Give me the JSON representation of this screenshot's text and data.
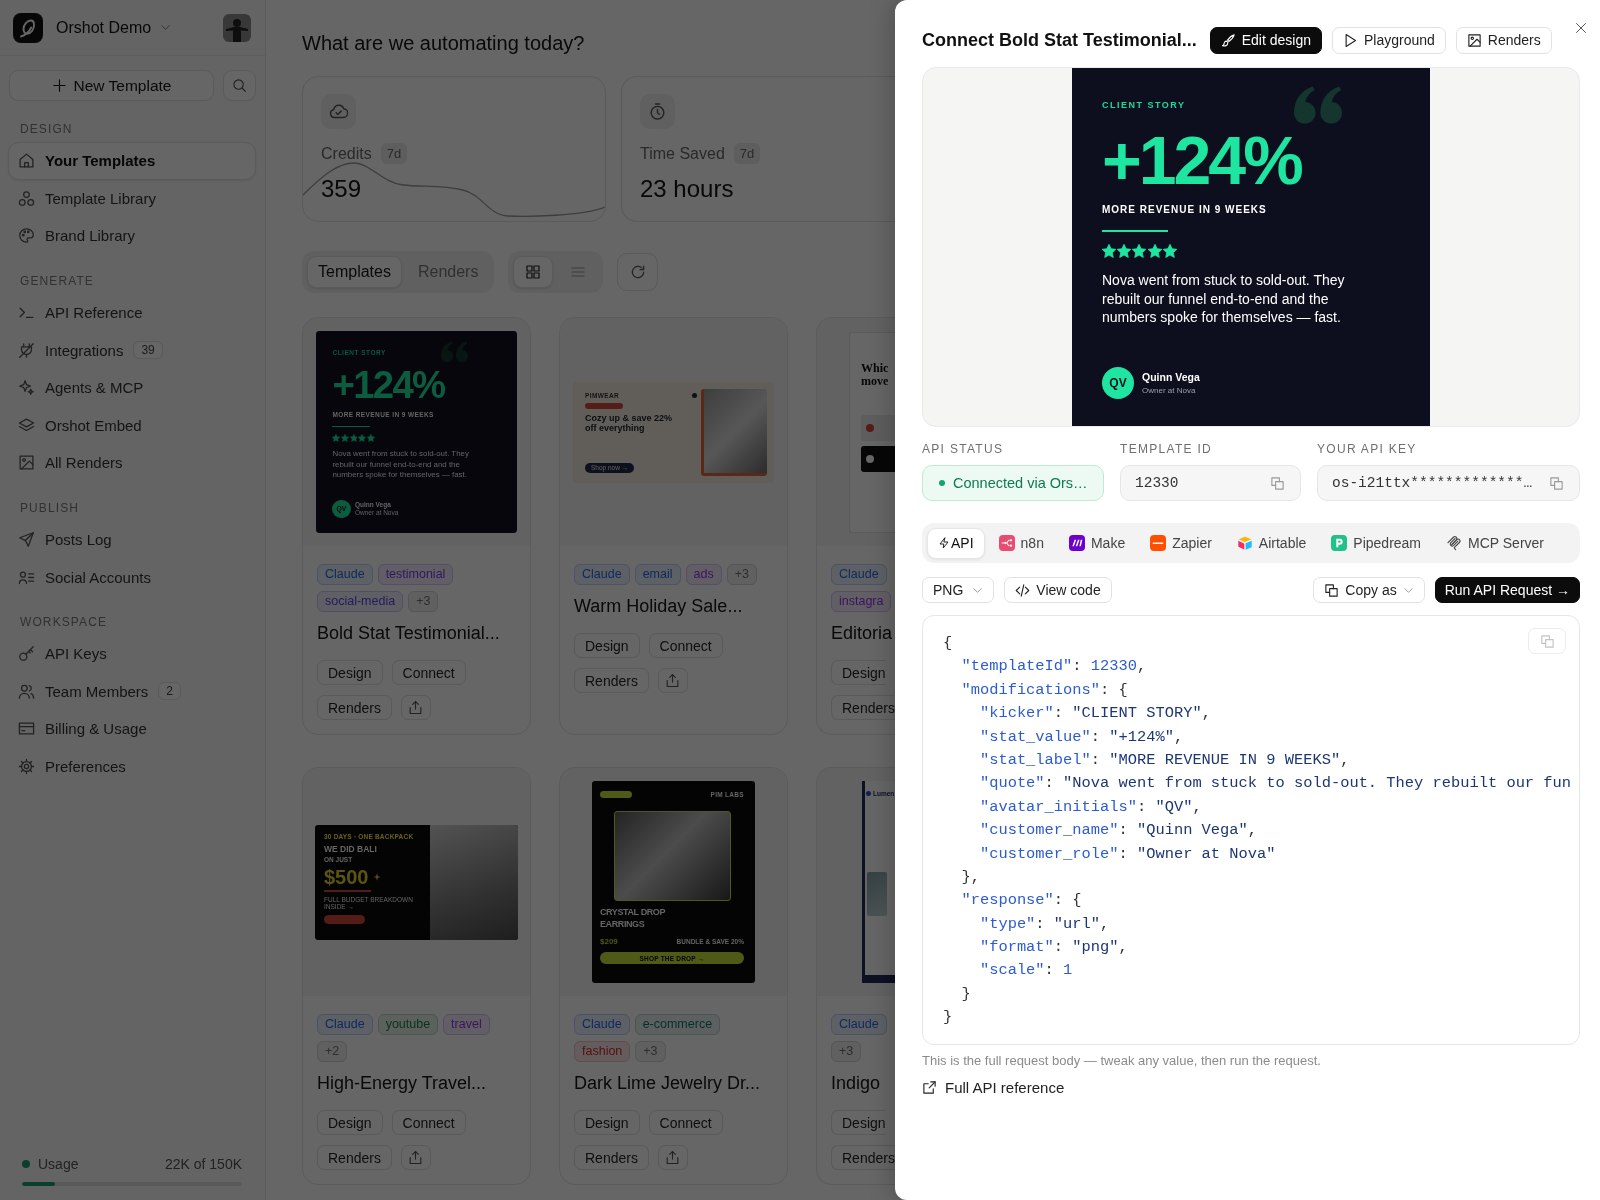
{
  "sidebar": {
    "workspace": "Orshot Demo",
    "new_template": "New Template",
    "sections": [
      {
        "title": "DESIGN",
        "items": [
          {
            "label": "Your Templates",
            "selected": true
          },
          {
            "label": "Template Library",
            "selected": false
          },
          {
            "label": "Brand Library",
            "selected": false
          }
        ]
      },
      {
        "title": "GENERATE",
        "items": [
          {
            "label": "API Reference",
            "selected": false
          },
          {
            "label": "Integrations",
            "badge": "39",
            "selected": false
          },
          {
            "label": "Agents & MCP",
            "selected": false
          },
          {
            "label": "Orshot Embed",
            "selected": false
          },
          {
            "label": "All Renders",
            "selected": false
          }
        ]
      },
      {
        "title": "PUBLISH",
        "items": [
          {
            "label": "Posts Log",
            "selected": false
          },
          {
            "label": "Social Accounts",
            "selected": false
          }
        ]
      },
      {
        "title": "WORKSPACE",
        "items": [
          {
            "label": "API Keys",
            "selected": false
          },
          {
            "label": "Team Members",
            "badge": "2",
            "selected": false
          },
          {
            "label": "Billing & Usage",
            "selected": false
          },
          {
            "label": "Preferences",
            "selected": false
          }
        ]
      }
    ],
    "usage": {
      "label": "Usage",
      "reading": "22K of 150K",
      "level": 0.15
    }
  },
  "main": {
    "title": "What are we automating today?",
    "stats": [
      {
        "label": "Credits",
        "period": "7d",
        "value": "359",
        "sparkline": true
      },
      {
        "label": "Time Saved",
        "period": "7d",
        "value": "23 hours",
        "sparkline": false
      }
    ],
    "tabs": [
      {
        "label": "Templates",
        "selected": true
      },
      {
        "label": "Renders",
        "selected": false
      }
    ],
    "view_modes": [
      {
        "selected": true
      },
      {
        "selected": false
      }
    ],
    "templates": [
      {
        "preview": {
          "kind": "testimonial",
          "kicker": "CLIENT STORY",
          "stat": "+124%",
          "stat_label": "MORE REVENUE IN 9 WEEKS",
          "stars": 5,
          "quote": "Nova went from stuck to sold-out. They rebuilt our funnel end-to-end and the numbers spoke for themselves — fast.",
          "initials": "QV",
          "name": "Quinn Vega",
          "role": "Owner at Nova"
        },
        "tags": [
          {
            "label": "Claude",
            "color": "#0f285e"
          },
          {
            "label": "testimonial",
            "color": "#32175f"
          },
          {
            "label": "social-media",
            "color": "#201c5c"
          },
          {
            "label": "+3",
            "color": "#2e2e2e"
          }
        ],
        "title": "Bold Stat Testimonial...",
        "button_rows": [
          [
            "Design",
            "Connect"
          ],
          [
            "Renders"
          ]
        ],
        "share": true
      },
      {
        "preview": {
          "kind": "promo_banner",
          "brand": "PIMWEAR",
          "heading": "Cozy up & save 22% off everything",
          "button": "Shop now →"
        },
        "tags": [
          {
            "label": "Claude",
            "color": "#0f285e"
          },
          {
            "label": "email",
            "color": "#0f285e"
          },
          {
            "label": "ads",
            "color": "#3b145e"
          },
          {
            "label": "+3",
            "color": "#2e2e2e"
          }
        ],
        "title": "Warm Holiday Sale...",
        "button_rows": [
          [
            "Design",
            "Connect"
          ],
          [
            "Renders"
          ]
        ],
        "share": true
      },
      {
        "preview": {
          "kind": "poll_post",
          "heading_lines": [
            "Whic",
            "move"
          ]
        },
        "tags": [
          {
            "label": "Claude",
            "color": "#0f285e"
          },
          {
            "label": "instagra",
            "color": "#3b145e"
          }
        ],
        "title": "Editoria",
        "button_rows": [
          [
            "Design"
          ],
          [
            "Renders"
          ]
        ],
        "share": false
      },
      {
        "preview": {
          "kind": "travel_banner",
          "kicker": "30 DAYS · ONE BACKPACK",
          "headline": "WE DID BALI",
          "subhead": "ON JUST",
          "price": "$500",
          "caption": "FULL BUDGET BREAKDOWN INSIDE →"
        },
        "tags": [
          {
            "label": "Claude",
            "color": "#0f285e"
          },
          {
            "label": "youtube",
            "color": "#083318"
          },
          {
            "label": "travel",
            "color": "#3b145e"
          },
          {
            "label": "+2",
            "color": "#2e2e2e"
          }
        ],
        "title": "High-Energy Travel...",
        "button_rows": [
          [
            "Design",
            "Connect"
          ],
          [
            "Renders"
          ]
        ],
        "share": true
      },
      {
        "preview": {
          "kind": "product_poster",
          "brand": "PIM LABS",
          "heading": "CRYSTAL DROP EARRINGS",
          "price": "$209",
          "offer": "BUNDLE & SAVE 20%",
          "button": "SHOP THE DROP →"
        },
        "tags": [
          {
            "label": "Claude",
            "color": "#0f285e"
          },
          {
            "label": "e-commerce",
            "color": "#062f2c"
          },
          {
            "label": "fashion",
            "color": "#580f0f"
          },
          {
            "label": "+3",
            "color": "#2e2e2e"
          }
        ],
        "title": "Dark Lime Jewelry Dr...",
        "button_rows": [
          [
            "Design",
            "Connect"
          ],
          [
            "Renders"
          ]
        ],
        "share": true
      },
      {
        "preview": {
          "kind": "newsletter",
          "brand": "Lumen"
        },
        "tags": [
          {
            "label": "Claude",
            "color": "#0f285e"
          },
          {
            "label": "+3",
            "color": "#2e2e2e"
          }
        ],
        "title": "Indigo",
        "button_rows": [
          [
            "Design"
          ],
          [
            "Renders"
          ]
        ],
        "share": false
      }
    ]
  },
  "drawer": {
    "title": "Connect Bold Stat Testimonial...",
    "header_buttons": [
      {
        "label": "Edit design",
        "kind": "primary"
      },
      {
        "label": "Playground",
        "kind": "secondary"
      },
      {
        "label": "Renders",
        "kind": "secondary"
      }
    ],
    "preview": {
      "kind": "testimonial",
      "kicker": "CLIENT STORY",
      "stat": "+124%",
      "stat_label": "MORE REVENUE IN 9 WEEKS",
      "stars": 5,
      "quote": "Nova went from stuck to sold-out. They rebuilt our funnel end-to-end and the numbers spoke for themselves — fast.",
      "initials": "QV",
      "name": "Quinn Vega",
      "role": "Owner at Nova"
    },
    "fields": [
      {
        "label": "API STATUS",
        "value": "Connected via Ors…",
        "kind": "status"
      },
      {
        "label": "TEMPLATE ID",
        "value": "12330",
        "kind": "copyable"
      },
      {
        "label": "YOUR API KEY",
        "value": "os-i21ttx*************…",
        "kind": "copyable"
      }
    ],
    "integrations": [
      {
        "label": "API",
        "selected": true
      },
      {
        "label": "n8n",
        "selected": false
      },
      {
        "label": "Make",
        "selected": false
      },
      {
        "label": "Zapier",
        "selected": false
      },
      {
        "label": "Airtable",
        "selected": false
      },
      {
        "label": "Pipedream",
        "selected": false
      },
      {
        "label": "MCP Server",
        "selected": false
      }
    ],
    "format": "PNG",
    "view_code": "View code",
    "copy_as": "Copy as",
    "run": "Run API Request →",
    "code_lines": [
      "{",
      "  \"templateId\": 12330,",
      "  \"modifications\": {",
      "    \"kicker\": \"CLIENT STORY\",",
      "    \"stat_value\": \"+124%\",",
      "    \"stat_label\": \"MORE REVENUE IN 9 WEEKS\",",
      "    \"quote\": \"Nova went from stuck to sold-out. They rebuilt our fun",
      "    \"avatar_initials\": \"QV\",",
      "    \"customer_name\": \"Quinn Vega\",",
      "    \"customer_role\": \"Owner at Nova\"",
      "  },",
      "  \"response\": {",
      "    \"type\": \"url\",",
      "    \"format\": \"png\",",
      "    \"scale\": 1",
      "  }",
      "}"
    ],
    "help": "This is the full request body — tweak any value, then run the request.",
    "link": "Full API reference"
  }
}
